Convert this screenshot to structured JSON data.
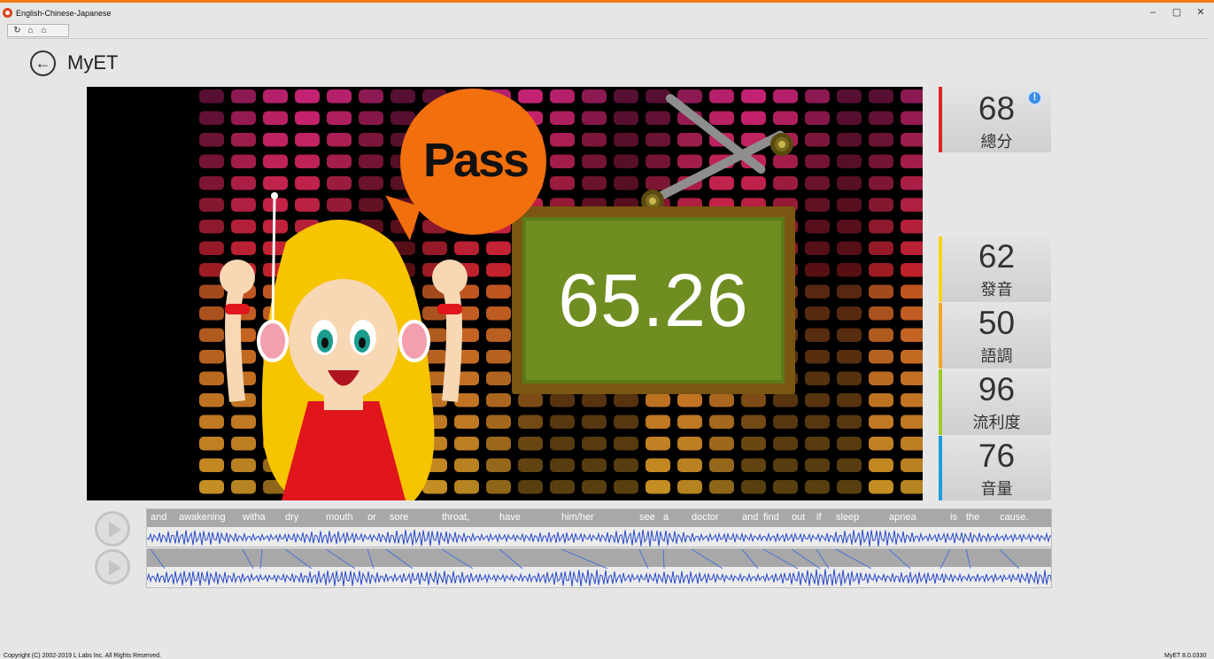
{
  "window": {
    "title": "English-Chinese-Japanese",
    "controls": {
      "minimize": "–",
      "maximize": "▢",
      "close": "✕"
    }
  },
  "nav": {
    "icons": [
      "reload-icon",
      "home-icon",
      "home-outline-icon"
    ],
    "glyphs": [
      "↻",
      "⌂",
      "⌂"
    ]
  },
  "header": {
    "back_glyph": "←",
    "title": "MyET"
  },
  "result": {
    "badge": "Pass",
    "score": "65.26"
  },
  "scores": {
    "total": {
      "value": "68",
      "label": "總分",
      "color": "#e02424",
      "info": "!"
    },
    "pronunciation": {
      "value": "62",
      "label": "發音",
      "color": "#f6d517"
    },
    "intonation": {
      "value": "50",
      "label": "語調",
      "color": "#f5a623"
    },
    "fluency": {
      "value": "96",
      "label": "流利度",
      "color": "#9ccc22"
    },
    "volume": {
      "value": "76",
      "label": "音量",
      "color": "#1e9be0"
    }
  },
  "transcript": {
    "words": [
      "and",
      "awakening",
      "witha",
      "dry",
      "mouth",
      "or",
      "sore",
      "throat,",
      "have",
      "him/her",
      "see",
      "a",
      "doctor",
      "and",
      "find",
      "out",
      "if",
      "sleep",
      "apnea",
      "is",
      "the",
      "cause."
    ]
  },
  "footer": {
    "copyright": "Copyright (C) 2002-2019 L Labs Inc. All Rights Reserved.",
    "version": "MyET 8.0.0330"
  }
}
